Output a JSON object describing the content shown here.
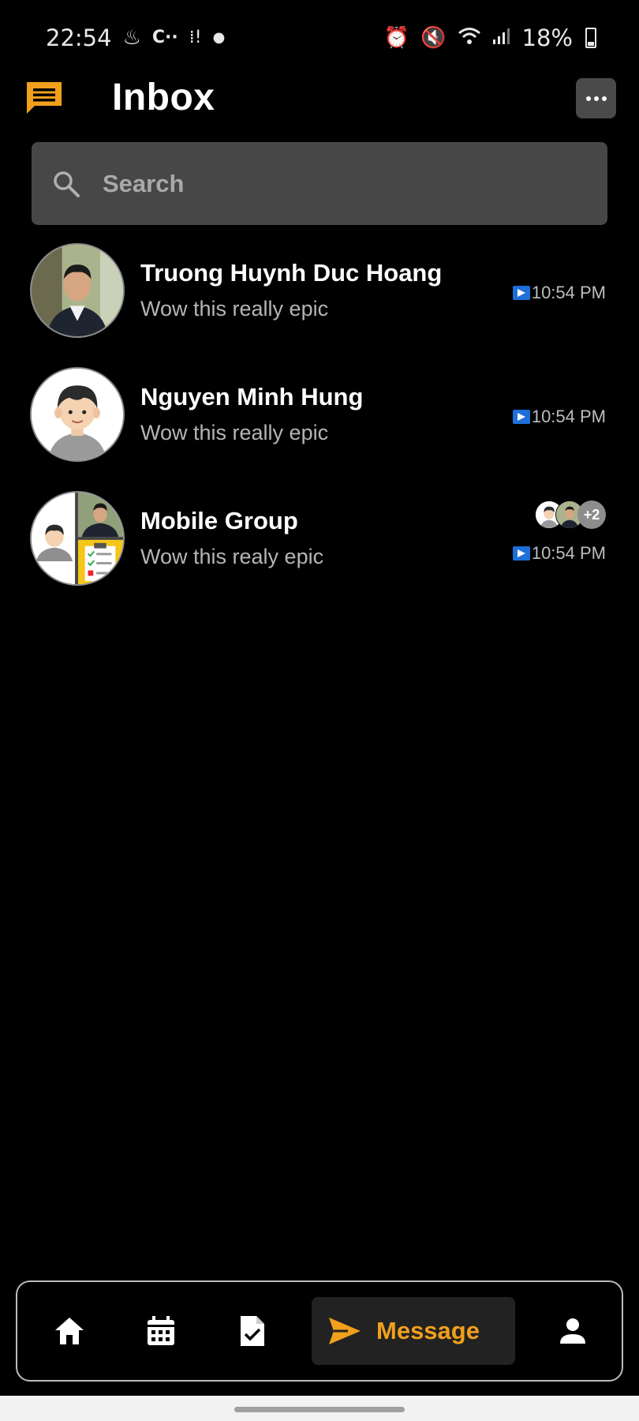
{
  "status_bar": {
    "time": "22:54",
    "battery": "18%",
    "left_icons": [
      "java-icon",
      "c-plus-icon",
      "steps-icon",
      "dot-icon"
    ],
    "right_icons": [
      "alarm-icon",
      "mute-icon",
      "wifi-icon",
      "signal-icon",
      "battery-icon"
    ]
  },
  "header": {
    "title": "Inbox",
    "logo_icon": "chat-icon",
    "more_icon": "more-icon",
    "accent": "#f0a01c"
  },
  "search": {
    "placeholder": "Search",
    "icon": "search-icon"
  },
  "conversations": [
    {
      "name": "Truong Huynh Duc Hoang",
      "preview": "Wow this really epic",
      "time": "10:54 PM"
    },
    {
      "name": "Nguyen Minh Hung",
      "preview": "Wow this really epic",
      "time": "10:54 PM"
    },
    {
      "name": "Mobile Group",
      "preview": "Wow this realy epic",
      "time": "10:54 PM",
      "extra_members": "+2"
    }
  ],
  "bottom_nav": {
    "items": [
      "home-icon",
      "calendar-icon",
      "task-icon",
      "send-icon",
      "person-icon"
    ],
    "active_label": "Message"
  }
}
